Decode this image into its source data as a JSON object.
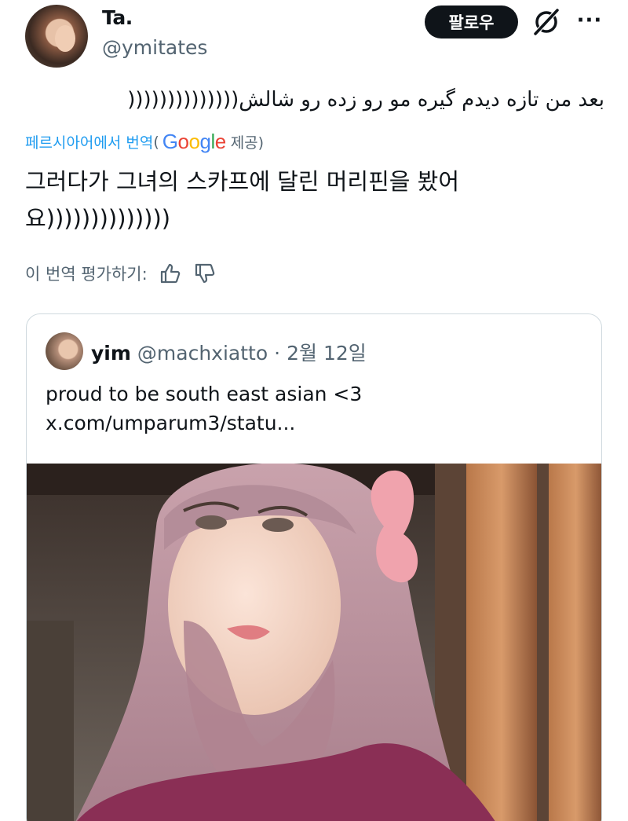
{
  "tweet": {
    "display_name": "Ta.",
    "handle": "@ymitates",
    "follow_label": "팔로우",
    "more_label": "···",
    "original_text": "بعد من تازه دیدم گیره مو رو زده رو شالش((((((((((((((",
    "translate": {
      "source_label": "페르시아어에서 번역",
      "open_paren": "(",
      "google": [
        "G",
        "o",
        "o",
        "g",
        "l",
        "e"
      ],
      "provided_label": "제공)"
    },
    "translated_text": "그러다가 그녀의 스카프에 달린 머리핀을 봤어요))))))))))))))",
    "rate_label": "이 번역 평가하기:"
  },
  "quote": {
    "name": "yim",
    "handle": "@machxiatto",
    "dot": "·",
    "date": "2월 12일",
    "text_line1": "proud to be south east asian <3",
    "text_line2": "x.com/umparum3/statu..."
  },
  "icons": {
    "grok": "grok-icon",
    "more": "more-icon",
    "thumbs_up": "thumbs-up-icon",
    "thumbs_down": "thumbs-down-icon"
  },
  "colors": {
    "text": "#0f1419",
    "secondary": "#536471",
    "link": "#1d9bf0",
    "border": "#cfd9de",
    "google_blue": "#4285f4",
    "google_red": "#ea4335",
    "google_yellow": "#fbbc05",
    "google_green": "#34a853"
  }
}
